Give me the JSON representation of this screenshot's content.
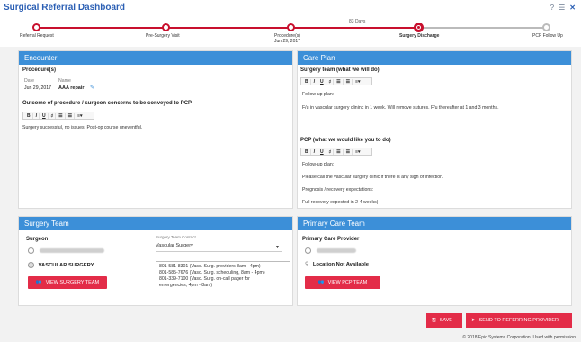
{
  "app": {
    "title": "Surgical Referral Dashboard"
  },
  "window_controls": {
    "help": "?",
    "menu": "☰",
    "close": "✕"
  },
  "timeline": {
    "days_label": "83 Days",
    "stages": [
      {
        "label": "Referral Request",
        "date": ""
      },
      {
        "label": "Pre-Surgery Visit",
        "date": ""
      },
      {
        "label": "Procedure(s)",
        "date": "Jun 29, 2017"
      },
      {
        "label": "Surgery Discharge",
        "date": ""
      },
      {
        "label": "PCP Follow Up",
        "date": ""
      }
    ]
  },
  "encounter": {
    "header": "Encounter",
    "procedures_label": "Procedure(s)",
    "col_date": "Date",
    "col_name": "Name",
    "row_date": "Jun 29, 2017",
    "row_name": "AAA repair",
    "outcome_label": "Outcome of procedure / surgeon concerns to be conveyed to PCP",
    "outcome_text": "Surgery successful, no issues.  Post-op course uneventful."
  },
  "care_plan": {
    "header": "Care Plan",
    "surgery_team_label": "Surgery team (what we will do)",
    "surgery_lines": [
      "Follow-up plan:",
      "F/u in vascular surgery clininc in 1 week.  Will remove sutures.  F/u thereafter at 1 and 3 months."
    ],
    "pcp_label": "PCP (what we would like you to do)",
    "pcp_lines": [
      "Follow-up plan:",
      "Please call the vascular surgery clinic if there is any sign of infection.",
      "Prognosis / recovery expectations:",
      "Full recovery expected in 2-4 weeks|"
    ]
  },
  "toolbar": {
    "bold": "B",
    "italic": "I",
    "underline": "U",
    "strike": "♯",
    "list1": "☰",
    "list2": "☰",
    "align": "≡▾"
  },
  "surgery_team": {
    "header": "Surgery Team",
    "surgeon_label": "Surgeon",
    "contact_label": "Surgery Team Contact",
    "contact_value": "Vascular Surgery",
    "dept": "VASCULAR SURGERY",
    "phones": [
      "801-581-8301 (Vasc. Surg. providers 8am - 4pm)",
      "801-585-7676 (Vasc. Surg. scheduling, 8am - 4pm)",
      "801-339-7100 (Vasc. Surg. on-call pager for",
      "emergencies, 4pm - 8am)"
    ],
    "button": "VIEW SURGERY TEAM"
  },
  "primary_care": {
    "header": "Primary Care Team",
    "provider_label": "Primary Care Provider",
    "location": "Location Not Available",
    "button": "VIEW PCP TEAM"
  },
  "footer": {
    "save": "SAVE",
    "send": "SEND TO REFERRING PROVIDER",
    "copyright": "© 2018 Epic Systems Corporation. Used with permission"
  },
  "colors": {
    "accent": "#3c8fd8",
    "brand_red": "#e32c48",
    "title_blue": "#2b5fb4"
  }
}
